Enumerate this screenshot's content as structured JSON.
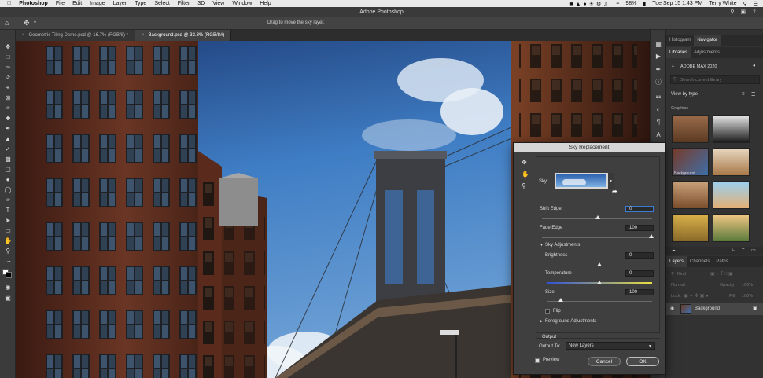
{
  "menubar": {
    "app": "Photoshop",
    "items": [
      "File",
      "Edit",
      "Image",
      "Layer",
      "Type",
      "Select",
      "Filter",
      "3D",
      "View",
      "Window",
      "Help"
    ],
    "battery": "98%",
    "clock": "Tue Sep 15  1:43 PM",
    "user": "Terry White"
  },
  "titlebar": {
    "title": "Adobe Photoshop"
  },
  "optionsbar": {
    "hint": "Drag to move the sky layer."
  },
  "tabs": [
    {
      "label": "Geometric Tiling Demo.psd @ 16.7% (RGB/8) *"
    },
    {
      "label": "Background.psd @ 33.3% (RGB/8#)"
    }
  ],
  "panels": {
    "top_tabs": [
      "Histogram",
      "Navigator"
    ],
    "lib_tabs": [
      "Libraries",
      "Adjustments"
    ],
    "library_name": "ADOBE MAX 2020",
    "search_placeholder": "Search current library",
    "view_by": "View by type",
    "section": "Graphics",
    "thumb_label": "Background",
    "layer_tabs": [
      "Layers",
      "Channels",
      "Paths"
    ],
    "kind": "Kind",
    "blend_mode": "Normal",
    "opacity_label": "Opacity:",
    "opacity_value": "100%",
    "lock_label": "Lock:",
    "fill_label": "Fill:",
    "fill_value": "100%",
    "layer_name": "Background"
  },
  "dialog": {
    "title": "Sky Replacement",
    "sky_label": "Sky:",
    "shift_edge": {
      "label": "Shift Edge",
      "value": "0"
    },
    "fade_edge": {
      "label": "Fade Edge",
      "value": "100"
    },
    "sky_adjustments": "Sky Adjustments",
    "brightness": {
      "label": "Brightness",
      "value": "0"
    },
    "temperature": {
      "label": "Temperature",
      "value": "0"
    },
    "size": {
      "label": "Size",
      "value": "100"
    },
    "flip": "Flip",
    "foreground": "Foreground Adjustments",
    "output": "Output",
    "output_to_label": "Output To:",
    "output_to_value": "New Layers",
    "preview": "Preview",
    "cancel": "Cancel",
    "ok": "OK"
  },
  "colors": {
    "accent": "#3a7bd5",
    "sky": "#2f6cb5",
    "brick": "#5a2c1f"
  }
}
